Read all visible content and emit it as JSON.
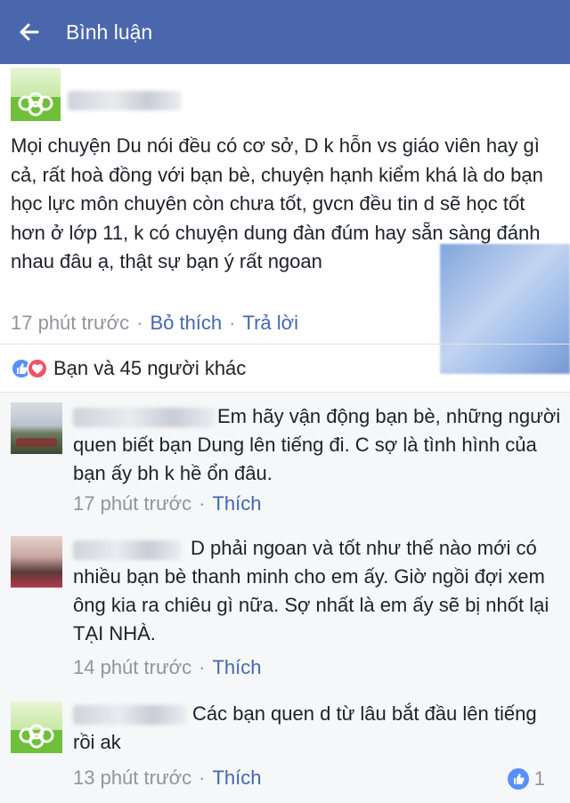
{
  "header": {
    "back_icon": "arrow-left-icon",
    "title": "Bình luận"
  },
  "colors": {
    "header_bg": "#4a67ad",
    "link": "#4267b2",
    "meta_text": "#90949c",
    "comments_bg": "#f6f7f9",
    "like_blue": "#5890ff",
    "love_red": "#f25268"
  },
  "post": {
    "text": "Mọi chuyện Du nói đều có cơ sở, D k hỗn vs giáo viên hay gì cả, rất hoà đồng với bạn bè, chuyện hạnh kiểm khá là do bạn học lực môn chuyên còn chưa tốt, gvcn đều tin d sẽ học tốt hơn ở lớp 11, k có chuyện dung đàn đúm hay sẵn sàng đánh nhau đâu ạ, thật sự bạn ý rất ngoan",
    "time": "17 phút trước",
    "like_label": "Bỏ thích",
    "reply_label": "Trả lời",
    "separator": "·"
  },
  "reactions": {
    "icons": [
      "like-icon",
      "love-icon"
    ],
    "text": "Bạn và 45 người khác"
  },
  "comments": [
    {
      "text": "Em hãy vận động bạn bè, những người quen biết bạn Dung lên tiếng đi. C sợ là tình hình của bạn ấy bh k hề ổn đâu.",
      "time": "17 phút trước",
      "like_label": "Thích"
    },
    {
      "text": "D phải ngoan và tốt như thế nào mới có nhiều bạn bè thanh minh cho em ấy. Giờ ngồi đợi xem ông kia ra chiêu gì nữa. Sợ nhất là em ấy sẽ bị nhốt lại TẠI NHÀ.",
      "time": "14 phút trước",
      "like_label": "Thích"
    },
    {
      "text": "Các bạn quen d từ lâu bắt đầu lên tiếng rồi ak",
      "time": "13 phút trước",
      "like_label": "Thích",
      "like_count": "1"
    }
  ]
}
